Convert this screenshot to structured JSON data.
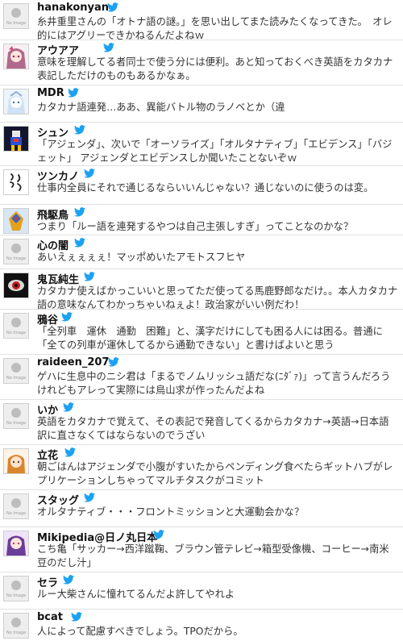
{
  "no_image_label": "No Image",
  "accent_color": "#1da1f2",
  "tweets": [
    {
      "name": "hanakonyan",
      "avatar": "no-image",
      "text": "糸井重里さんの「オトナ語の謎。」を思い出してまた読みたくなってきた。　オレ的にはアグリーできかねるんだよねｗ"
    },
    {
      "name": "アウアア",
      "avatar": "anime-girl",
      "text": "意味を理解してる者同士で使う分には便利。あと知っておくべき英語をカタカナ表記しただけのものもあるかなぁ。"
    },
    {
      "name": "MDR",
      "avatar": "anime-character",
      "text": "カタカナ語連発…ああ、異能バトル物のラノベとか（違"
    },
    {
      "name": "シュン",
      "avatar": "robot",
      "text": "「アジェンダ」、次いで「オーソライズ」「オルタナティブ」「エビデンス」「バジェット」 アジェンダとエビデンスしか聞いたことないぞｗ"
    },
    {
      "name": "ツンカノ",
      "avatar": "calligraphy",
      "text": "仕事内全員にそれで通じるならいいんじゃない？通じないのに使うのは変。"
    },
    {
      "name": "飛駆鳥",
      "avatar": "colorful-robot",
      "text": "つまり「ルー語を連発するやつは自己主張しすぎ」ってことなのかな？"
    },
    {
      "name": "心の闇",
      "avatar": "no-image",
      "text": "あいえぇぇぇぇ！マッポめいたアモトスフヒヤ"
    },
    {
      "name": "鬼瓦純生",
      "avatar": "red-eye",
      "text": "カタカナ使えばかっこいいと思ってただ使ってる馬鹿野郎なだけ。。本人カタカナ語の意味なんてわかっちゃいねぇよ！政治家がいい例だわ！"
    },
    {
      "name": "鴉谷",
      "avatar": "no-image",
      "text": "「全列車　運休　通勤　困難」と、漢字だけにしても困る人には困る。普通に「全ての列車が運休してるから通勤できない」と書けばよいと思う"
    },
    {
      "name": "raideen_207",
      "avatar": "no-image",
      "text": "ゲハに生息中のニシ君は「まるでノムリッシュ語だな(ﾆﾀﾞｧ)」って言うんだろうけれどもアレって実際には鳥山求が作ったんだよね"
    },
    {
      "name": "いか",
      "avatar": "no-image",
      "text": "英語をカタカナで覚えて、その表記で発音してくるからカタカナ→英語→日本語訳に直さなくてはならないのでうざい"
    },
    {
      "name": "立花",
      "avatar": "anime-girl-orange",
      "text": "朝ごはんはアジェンダで小腹がすいたからペンディング食べたらギットハブがレプリケーションしちゃってマルチタスクがコミット"
    },
    {
      "name": "スタッグ",
      "avatar": "no-image",
      "text": "オルタナティブ・・・フロントミッションと大運動会かな？"
    },
    {
      "name": "Mikipedia@日ノ丸日本",
      "avatar": "anime-girl-pink",
      "text": "こち亀「サッカー→西洋蹴鞠、ブラウン管テレビ→箱型受像機、コーヒー→南米豆のだし汁」"
    },
    {
      "name": "セラ",
      "avatar": "no-image",
      "text": "ルー大柴さんに憧れてるんだよ許してやれよ"
    },
    {
      "name": "bcat",
      "avatar": "no-image",
      "text": "人によって配慮すべきでしょう。TPOだから。"
    }
  ]
}
